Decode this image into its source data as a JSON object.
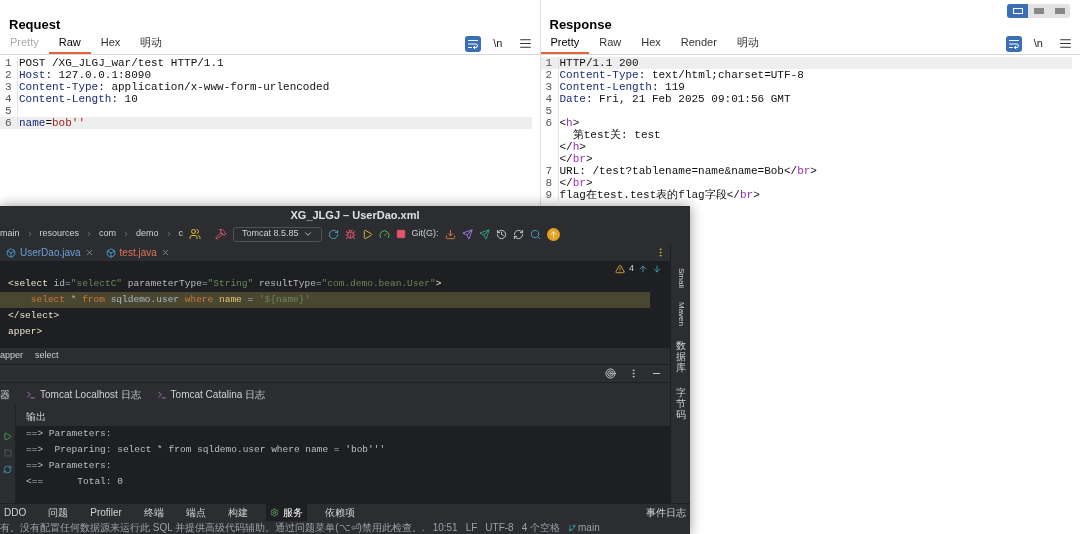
{
  "layout_toggle": [
    {
      "selected": true
    },
    {
      "selected": false
    },
    {
      "selected": false
    }
  ],
  "request": {
    "title": "Request",
    "newline_label": "\\n",
    "tabs": [
      {
        "label": "Pretty",
        "selected": false,
        "disabled": true
      },
      {
        "label": "Raw",
        "selected": true,
        "disabled": false
      },
      {
        "label": "Hex",
        "selected": false,
        "disabled": false
      },
      {
        "label": "明动",
        "selected": false,
        "disabled": false
      }
    ],
    "lines": [
      {
        "number": "1",
        "highlighted": false,
        "segments": [
          {
            "kind": "plain",
            "text": "POST /XG_JLGJ_war/test HTTP/1.1"
          }
        ]
      },
      {
        "number": "2",
        "highlighted": false,
        "segments": [
          {
            "kind": "key",
            "text": "Host"
          },
          {
            "kind": "plain",
            "text": ": 127.0.0.1:8090"
          }
        ]
      },
      {
        "number": "3",
        "highlighted": false,
        "segments": [
          {
            "kind": "key",
            "text": "Content-Type"
          },
          {
            "kind": "plain",
            "text": ": application/x-www-form-urlencoded"
          }
        ]
      },
      {
        "number": "4",
        "highlighted": false,
        "segments": [
          {
            "kind": "key",
            "text": "Content-Length"
          },
          {
            "kind": "plain",
            "text": ": 10"
          }
        ]
      },
      {
        "number": "5",
        "highlighted": false
      },
      {
        "number": "6",
        "highlighted": true,
        "segments": [
          {
            "kind": "key",
            "text": "name"
          },
          {
            "kind": "plain",
            "text": "="
          },
          {
            "kind": "value",
            "text": "bob''"
          }
        ]
      }
    ]
  },
  "response": {
    "title": "Response",
    "newline_label": "\\n",
    "tabs": [
      {
        "label": "Pretty",
        "selected": true,
        "disabled": false
      },
      {
        "label": "Raw",
        "selected": false,
        "disabled": false
      },
      {
        "label": "Hex",
        "selected": false,
        "disabled": false
      },
      {
        "label": "Render",
        "selected": false,
        "disabled": false
      },
      {
        "label": "明动",
        "selected": false,
        "disabled": false
      }
    ],
    "lines": [
      {
        "number": "1",
        "highlighted": true,
        "segments": [
          {
            "kind": "plain",
            "text": "HTTP/1.1 200"
          }
        ]
      },
      {
        "number": "2",
        "highlighted": false,
        "segments": [
          {
            "kind": "key",
            "text": "Content-Type"
          },
          {
            "kind": "plain",
            "text": ": text/html;charset=UTF-8"
          }
        ]
      },
      {
        "number": "3",
        "highlighted": false,
        "segments": [
          {
            "kind": "key",
            "text": "Content-Length"
          },
          {
            "kind": "plain",
            "text": ": 119"
          }
        ]
      },
      {
        "number": "4",
        "highlighted": false,
        "segments": [
          {
            "kind": "key",
            "text": "Date"
          },
          {
            "kind": "plain",
            "text": ": Fri, 21 Feb 2025 09:01:56 GMT"
          }
        ]
      },
      {
        "number": "5",
        "highlighted": false
      },
      {
        "number": "6",
        "highlighted": false,
        "segments": [
          {
            "kind": "plain",
            "text": "<"
          },
          {
            "kind": "tag",
            "text": "h"
          },
          {
            "kind": "plain",
            "text": ">"
          }
        ]
      },
      {
        "highlighted": false,
        "segments": [
          {
            "kind": "plain",
            "text": "  第test关: test"
          }
        ]
      },
      {
        "highlighted": false,
        "segments": [
          {
            "kind": "plain",
            "text": "</"
          },
          {
            "kind": "tag",
            "text": "h"
          },
          {
            "kind": "plain",
            "text": ">"
          }
        ]
      },
      {
        "highlighted": false,
        "segments": [
          {
            "kind": "plain",
            "text": "</"
          },
          {
            "kind": "tag",
            "text": "br"
          },
          {
            "kind": "plain",
            "text": ">"
          }
        ]
      },
      {
        "number": "7",
        "highlighted": false,
        "segments": [
          {
            "kind": "plain",
            "text": "URL: /test?tablename=name&name=Bob</"
          },
          {
            "kind": "tag",
            "text": "br"
          },
          {
            "kind": "plain",
            "text": ">"
          }
        ]
      },
      {
        "number": "8",
        "highlighted": false,
        "segments": [
          {
            "kind": "plain",
            "text": "</"
          },
          {
            "kind": "tag",
            "text": "br"
          },
          {
            "kind": "plain",
            "text": ">"
          }
        ]
      },
      {
        "number": "9",
        "highlighted": false,
        "segments": [
          {
            "kind": "plain",
            "text": "flag在test.test表的flag字段</"
          },
          {
            "kind": "tag",
            "text": "br"
          },
          {
            "kind": "plain",
            "text": ">"
          }
        ]
      }
    ]
  },
  "ide": {
    "title": "XG_JLGJ – UserDao.xml",
    "breadcrumb": [
      "main",
      "resources",
      "com",
      "demo",
      "c"
    ],
    "run_config": "Tomcat 8.5.85",
    "git_label": "Git(G):",
    "tabs": [
      {
        "label": "UserDao.java",
        "color": "#6f9fdc"
      },
      {
        "label": "test.java",
        "color": "#e0735a"
      }
    ],
    "warnings": "4",
    "code_lines": [
      {
        "highlighted": false,
        "segments": [
          {
            "kind": "tag",
            "text": "<select"
          },
          {
            "kind": "attr",
            "text": " id"
          },
          {
            "kind": "plain",
            "text": "="
          },
          {
            "kind": "str",
            "text": "\"selectC\""
          },
          {
            "kind": "attr",
            "text": " parameterType"
          },
          {
            "kind": "plain",
            "text": "="
          },
          {
            "kind": "str",
            "text": "\"String\""
          },
          {
            "kind": "attr",
            "text": " resultType"
          },
          {
            "kind": "plain",
            "text": "="
          },
          {
            "kind": "str",
            "text": "\"com.demo.bean.User\""
          },
          {
            "kind": "tag",
            "text": ">"
          }
        ]
      },
      {
        "highlighted": true,
        "segments": [
          {
            "kind": "kw",
            "text": "    select"
          },
          {
            "kind": "plain",
            "text": " * "
          },
          {
            "kind": "kw",
            "text": "from"
          },
          {
            "kind": "plain",
            "text": " sqldemo.user "
          },
          {
            "kind": "kw",
            "text": "where"
          },
          {
            "kind": "ident",
            "text": " name"
          },
          {
            "kind": "plain",
            "text": " = "
          },
          {
            "kind": "str",
            "text": "'${name}'"
          }
        ]
      },
      {
        "highlighted": false,
        "segments": [
          {
            "kind": "tag",
            "text": "</select>"
          }
        ]
      },
      {
        "highlighted": false,
        "segments": [
          {
            "kind": "tag",
            "text": "apper>"
          }
        ]
      }
    ],
    "path": [
      "apper",
      "select"
    ],
    "log_tabs": [
      "器",
      "Tomcat Localhost 日志",
      "Tomcat Catalina 日志"
    ],
    "output_label": "输出",
    "console": [
      "==> Parameters:",
      "==>  Preparing: select * from sqldemo.user where name = 'bob'''",
      "==> Parameters:",
      "<==      Total: 0"
    ],
    "tool_tabs": [
      {
        "label": "DDO",
        "selected": false
      },
      {
        "label": "问题",
        "selected": false
      },
      {
        "label": "Profiler",
        "selected": false
      },
      {
        "label": "终端",
        "selected": false
      },
      {
        "label": "端点",
        "selected": false
      },
      {
        "label": "构建",
        "selected": false
      },
      {
        "label": "服务",
        "selected": true
      },
      {
        "label": "依赖项",
        "selected": false
      }
    ],
    "event_log": "事件日志",
    "status_message": "有。没有配置任何数据源来运行此 SQL 并提供高级代码辅助。通过问题菜单(⌥⏎)禁用此检查。.",
    "status_items": [
      "10:51",
      "LF",
      "UTF-8",
      "4 个空格"
    ],
    "branch": "main",
    "side_tools": [
      {
        "label": "Smali",
        "kind": "latin"
      },
      {
        "label": "Maven",
        "kind": "latin"
      },
      {
        "label": "数据库",
        "kind": "cjk"
      },
      {
        "label": "字节码",
        "kind": "cjk"
      }
    ]
  }
}
